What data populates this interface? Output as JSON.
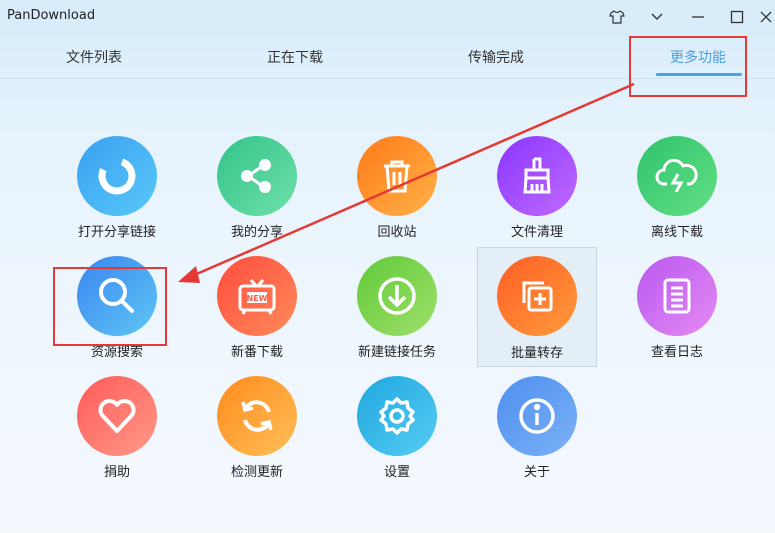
{
  "app": {
    "title": "PanDownload"
  },
  "window_controls": [
    {
      "name": "skin-icon"
    },
    {
      "name": "chevron-down-icon"
    },
    {
      "name": "minimize-icon"
    },
    {
      "name": "maximize-icon"
    },
    {
      "name": "close-icon"
    }
  ],
  "tabs": [
    {
      "label": "文件列表"
    },
    {
      "label": "正在下载"
    },
    {
      "label": "传输完成"
    },
    {
      "label": "更多功能",
      "active": true
    }
  ],
  "features": [
    {
      "label": "打开分享链接",
      "icon": "share-link-icon",
      "colors": [
        "#3aa0f2",
        "#58c8f8"
      ]
    },
    {
      "label": "我的分享",
      "icon": "share-icon",
      "colors": [
        "#33c38a",
        "#6fe0a9"
      ]
    },
    {
      "label": "回收站",
      "icon": "trash-icon",
      "colors": [
        "#ff7a1a",
        "#ffb247"
      ]
    },
    {
      "label": "文件清理",
      "icon": "brush-icon",
      "colors": [
        "#8a35ff",
        "#c06bff"
      ]
    },
    {
      "label": "离线下载",
      "icon": "cloud-download-icon",
      "colors": [
        "#2fc36b",
        "#63df85"
      ]
    },
    {
      "label": "资源搜索",
      "icon": "search-icon",
      "colors": [
        "#3b86f0",
        "#5ec6f4"
      ]
    },
    {
      "label": "新番下载",
      "icon": "tv-new-icon",
      "colors": [
        "#ff4d3d",
        "#ff8a5a"
      ]
    },
    {
      "label": "新建链接任务",
      "icon": "download-circle-icon",
      "colors": [
        "#61c93a",
        "#9fe06a"
      ]
    },
    {
      "label": "批量转存",
      "icon": "batch-save-icon",
      "colors": [
        "#ff5d24",
        "#ff9c3c"
      ]
    },
    {
      "label": "查看日志",
      "icon": "log-icon",
      "colors": [
        "#b858f0",
        "#e58bf2"
      ]
    },
    {
      "label": "捐助",
      "icon": "heart-icon",
      "colors": [
        "#ff5a5a",
        "#ff9a88"
      ]
    },
    {
      "label": "检测更新",
      "icon": "refresh-icon",
      "colors": [
        "#ff8a1e",
        "#ffc057"
      ]
    },
    {
      "label": "设置",
      "icon": "gear-icon",
      "colors": [
        "#1fa7df",
        "#56cdf3"
      ]
    },
    {
      "label": "关于",
      "icon": "info-icon",
      "colors": [
        "#4e8ff0",
        "#7bb1f5"
      ]
    }
  ]
}
